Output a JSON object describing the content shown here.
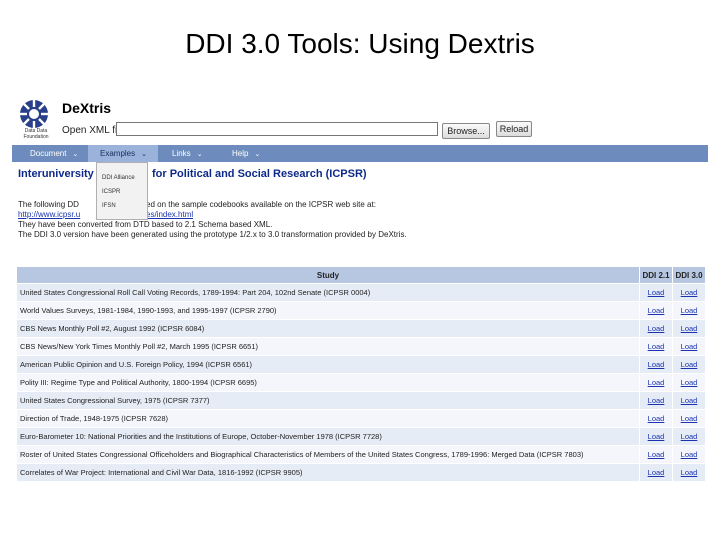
{
  "slide": {
    "title": "DDI 3.0 Tools: Using Dextris"
  },
  "app": {
    "name": "DeXtris",
    "logo_caption": "Data Data Foundation",
    "open_label": "Open XML file:",
    "file_value": "",
    "browse_label": "Browse...",
    "reload_label": "Reload"
  },
  "menu": {
    "items": [
      {
        "label": "Document"
      },
      {
        "label": "Examples"
      },
      {
        "label": "Links"
      },
      {
        "label": "Help"
      }
    ],
    "chevron": "⌄"
  },
  "dropdown": {
    "items": [
      "DDI Alliance",
      "ICSPR",
      "IFSN"
    ]
  },
  "page": {
    "title_left": "Interuniversity",
    "title_right": "for Political and Social Research (ICPSR)",
    "desc_line1_a": "The following DD",
    "desc_line1_b": "ed on the sample codebooks available on the ICPSR web site at:",
    "link_a": "http://www.icpsr.u",
    "link_b": "es/index.html",
    "desc_line3": "They have been converted from DTD based to 2.1 Schema based XML.",
    "desc_line4": "The DDI 3.0 version have been generated using the prototype 1/2.x to 3.0 transformation provided by DeXtris."
  },
  "table": {
    "headers": {
      "study": "Study",
      "ddi21": "DDI 2.1",
      "ddi30": "DDI 3.0"
    },
    "load_label": "Load",
    "rows": [
      "United States Congressional Roll Call Voting Records, 1789-1994: Part 204, 102nd Senate (ICPSR 0004)",
      "World Values Surveys, 1981-1984, 1990-1993, and 1995-1997 (ICPSR 2790)",
      "CBS News Monthly Poll #2, August 1992 (ICPSR 6084)",
      "CBS News/New York Times Monthly Poll #2, March 1995 (ICPSR 6651)",
      "American Public Opinion and U.S. Foreign Policy, 1994 (ICPSR 6561)",
      "Polity III: Regime Type and Political Authority, 1800-1994 (ICPSR 6695)",
      "United States Congressional Survey, 1975 (ICPSR 7377)",
      "Direction of Trade, 1948-1975 (ICPSR 7628)",
      "Euro-Barometer 10: National Priorities and the Institutions of Europe, October-November 1978 (ICPSR 7728)",
      "Roster of United States Congressional Officeholders and Biographical Characteristics of Members of the United States Congress, 1789-1996: Merged Data (ICPSR 7803)",
      "Correlates of War Project: International and Civil War Data, 1816-1992 (ICPSR 9905)"
    ]
  },
  "colors": {
    "menubar": "#6d8cbd",
    "header_row": "#b7c7e2",
    "link": "#1a34b0",
    "title": "#0d2a8a"
  }
}
